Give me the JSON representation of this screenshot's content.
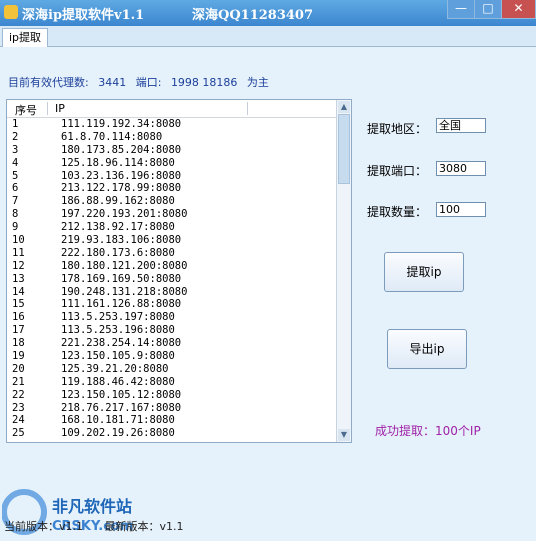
{
  "window": {
    "title": "深海ip提取软件v1.1",
    "title_extra": "深海QQ11283407",
    "min_glyph": "—",
    "max_glyph": "□",
    "close_glyph": "✕"
  },
  "tabs": [
    {
      "label": "ip提取"
    }
  ],
  "info": {
    "count_label": "目前有效代理数:",
    "count_value": "3441",
    "port_label": "端口:",
    "port_values": "1998 18186",
    "port_note": "为主"
  },
  "list": {
    "headers": [
      "序号",
      "IP"
    ],
    "rows": [
      {
        "n": "1",
        "ip": "111.119.192.34:8080"
      },
      {
        "n": "2",
        "ip": "61.8.70.114:8080"
      },
      {
        "n": "3",
        "ip": "180.173.85.204:8080"
      },
      {
        "n": "4",
        "ip": "125.18.96.114:8080"
      },
      {
        "n": "5",
        "ip": "103.23.136.196:8080"
      },
      {
        "n": "6",
        "ip": "213.122.178.99:8080"
      },
      {
        "n": "7",
        "ip": "186.88.99.162:8080"
      },
      {
        "n": "8",
        "ip": "197.220.193.201:8080"
      },
      {
        "n": "9",
        "ip": "212.138.92.17:8080"
      },
      {
        "n": "10",
        "ip": "219.93.183.106:8080"
      },
      {
        "n": "11",
        "ip": "222.180.173.6:8080"
      },
      {
        "n": "12",
        "ip": "180.180.121.200:8080"
      },
      {
        "n": "13",
        "ip": "178.169.169.50:8080"
      },
      {
        "n": "14",
        "ip": "190.248.131.218:8080"
      },
      {
        "n": "15",
        "ip": "111.161.126.88:8080"
      },
      {
        "n": "16",
        "ip": "113.5.253.197:8080"
      },
      {
        "n": "17",
        "ip": "113.5.253.196:8080"
      },
      {
        "n": "18",
        "ip": "221.238.254.14:8080"
      },
      {
        "n": "19",
        "ip": "123.150.105.9:8080"
      },
      {
        "n": "20",
        "ip": "125.39.21.20:8080"
      },
      {
        "n": "21",
        "ip": "119.188.46.42:8080"
      },
      {
        "n": "22",
        "ip": "123.150.105.12:8080"
      },
      {
        "n": "23",
        "ip": "218.76.217.167:8080"
      },
      {
        "n": "24",
        "ip": "168.10.181.71:8080"
      },
      {
        "n": "25",
        "ip": "109.202.19.26:8080"
      }
    ]
  },
  "form": {
    "region_label": "提取地区：",
    "region_value": "全国",
    "port_label": "提取端口：",
    "port_value": "3080",
    "qty_label": "提取数量：",
    "qty_value": "100"
  },
  "buttons": {
    "extract": "提取ip",
    "export": "导出ip"
  },
  "status": {
    "success": "成功提取：100个IP",
    "current_version_label": "当前版本：v1.1",
    "latest_version_label": "最新版本：v1.1"
  },
  "watermark": {
    "text": "非凡软件站",
    "sub": "CRSKY.com"
  }
}
